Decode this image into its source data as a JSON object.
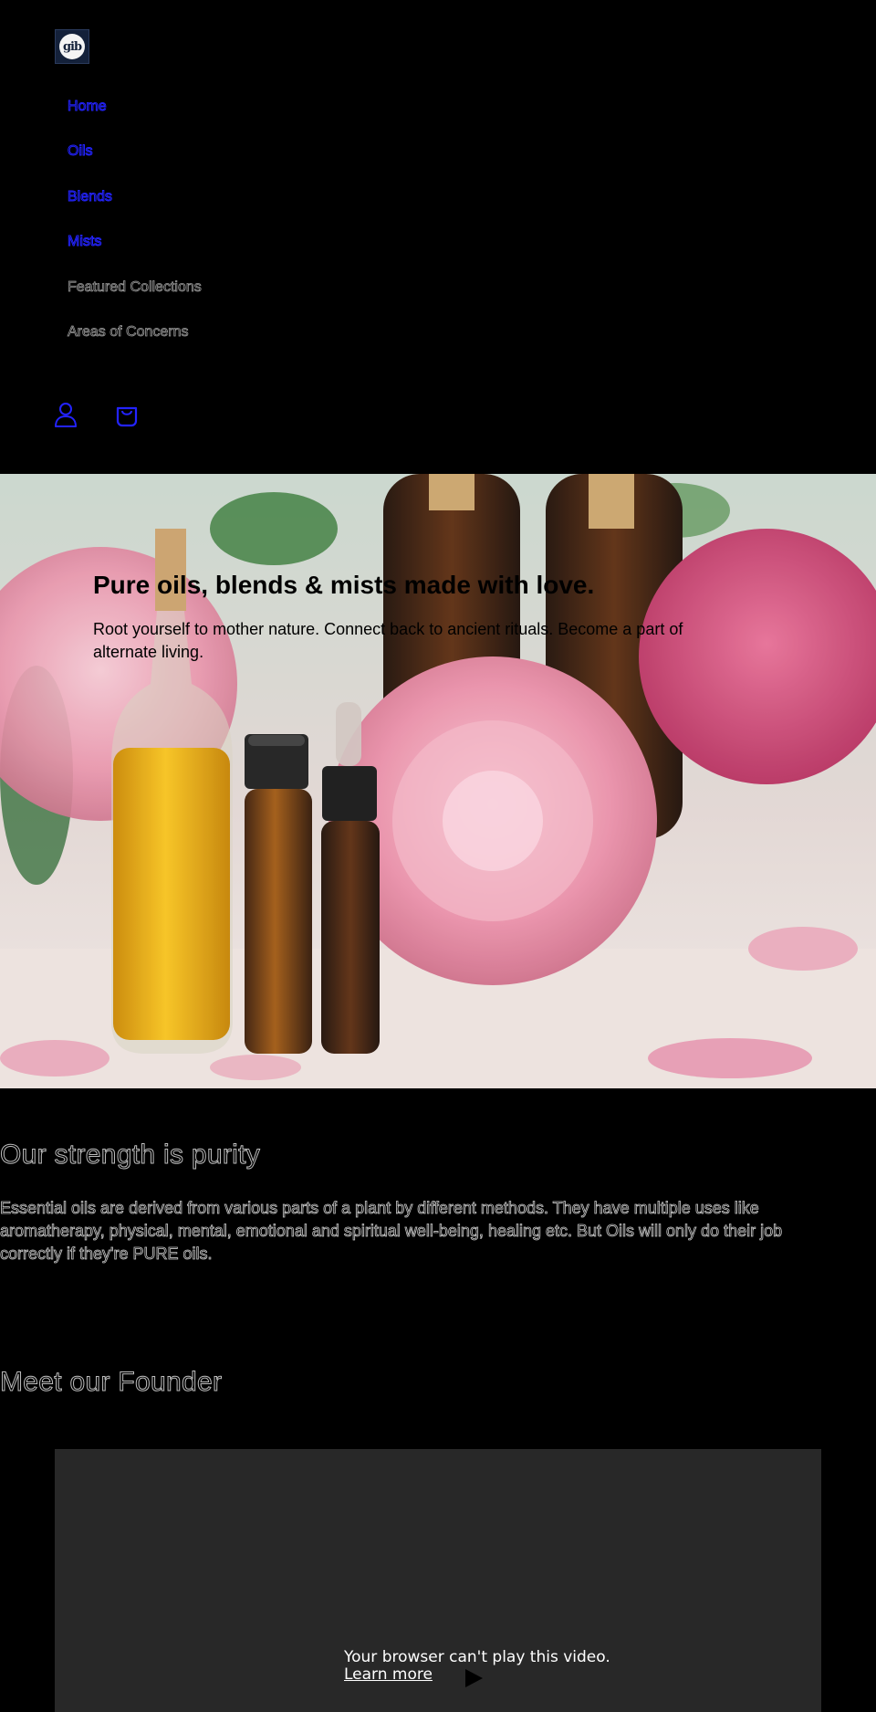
{
  "header": {
    "logo_text": "gib",
    "nav": [
      {
        "label": "Home",
        "style": "link"
      },
      {
        "label": "Oils",
        "style": "link"
      },
      {
        "label": "Blends",
        "style": "link"
      },
      {
        "label": "Mists",
        "style": "link"
      },
      {
        "label": "Featured Collections",
        "style": "plain"
      },
      {
        "label": "Areas of Concerns",
        "style": "plain"
      }
    ],
    "icons": [
      "account-icon",
      "cart-icon"
    ]
  },
  "hero": {
    "title": "Pure oils, blends & mists made with love.",
    "subtitle": "Root yourself to mother nature. Connect back to ancient rituals. Become a part of alternate living."
  },
  "purity": {
    "title": "Our strength is purity",
    "text": "Essential oils are derived from various parts of a plant by different methods. They have multiple uses like aromatherapy, physical, mental, emotional and spiritual well-being, healing etc. But Oils will only do their job correctly if they're PURE oils."
  },
  "founder": {
    "title": "Meet our Founder",
    "video_message": "Your browser can't play this video.",
    "learn_more": "Learn more"
  },
  "colors": {
    "background": "#000000",
    "link": "#2323ff",
    "video_bg": "#282828",
    "logo_bg": "#14213a"
  }
}
